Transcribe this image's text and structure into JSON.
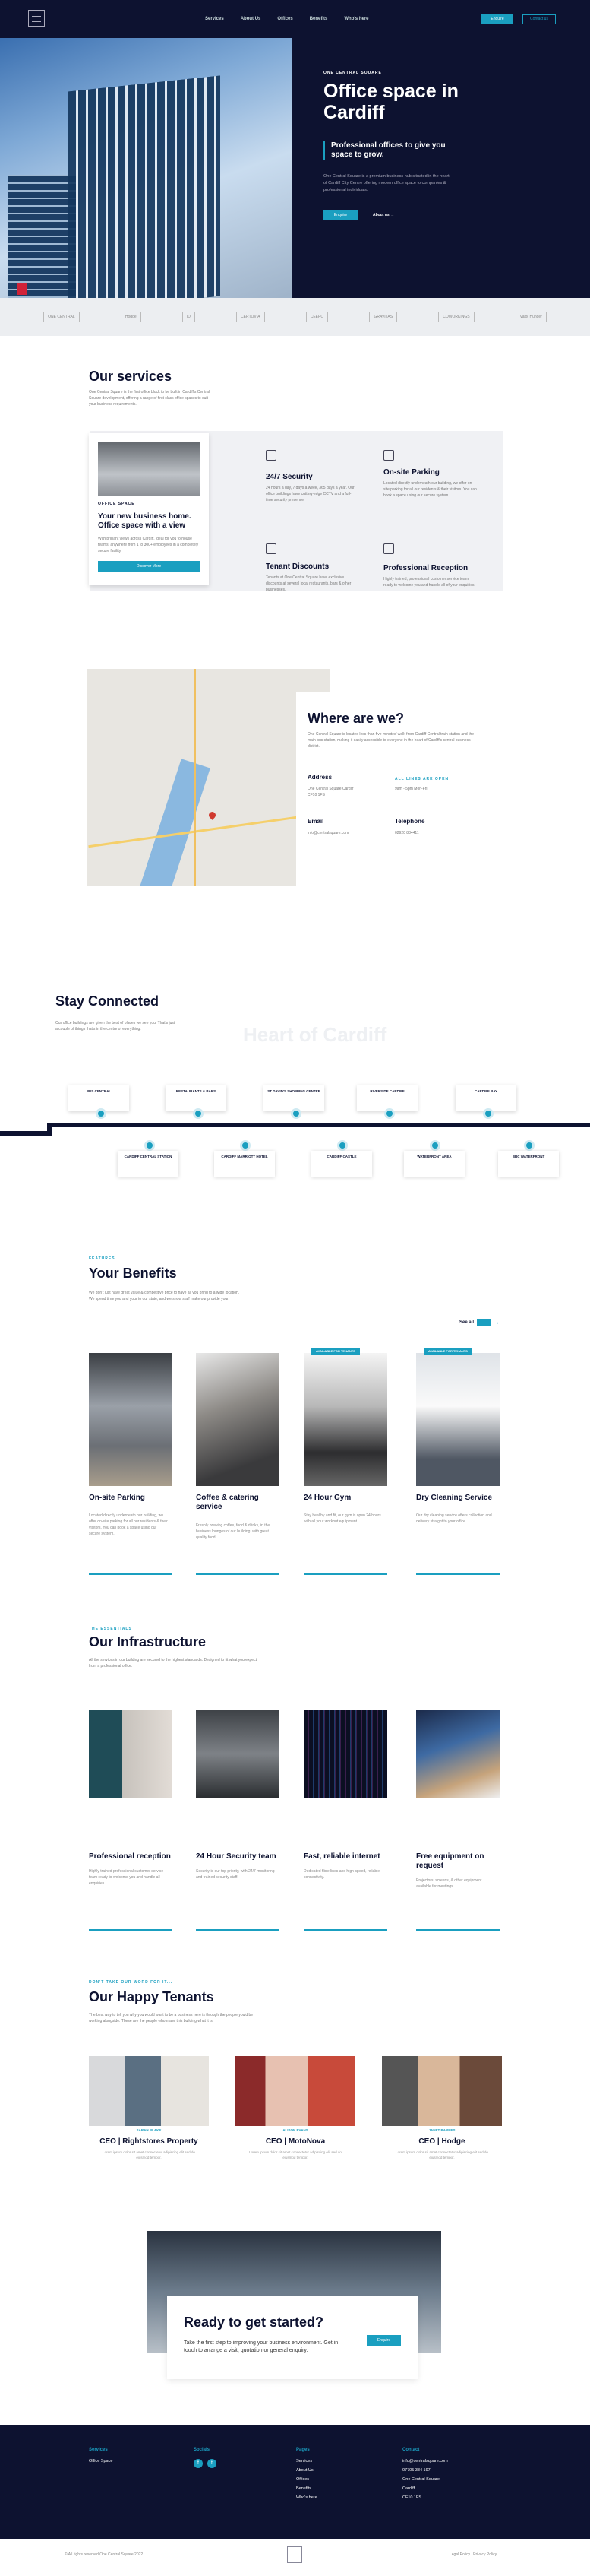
{
  "nav": {
    "links": [
      "Services",
      "About Us",
      "Offices",
      "Benefits",
      "Who's here"
    ],
    "btn_primary": "Enquire",
    "btn_secondary": "Contact us"
  },
  "hero": {
    "eyebrow": "ONE CENTRAL SQUARE",
    "title": "Office space in Cardiff",
    "quote": "Professional offices to give you space to grow.",
    "desc": "One Central Square is a premium business hub situated in the heart of Cardiff City Centre offering modern office space to companies & professional individuals.",
    "enquire": "Enquire",
    "about": "About us"
  },
  "logos": [
    "ONE CENTRAL",
    "Hodge",
    "ID",
    "CERTOVIA",
    "CEEPO",
    "GRAVITAS",
    "COWORKINGS",
    "Valor Hunger"
  ],
  "services": {
    "title": "Our services",
    "intro": "One Central Square is the first office block to be built in Cardiff's Central Square development, offering a range of first class office spaces to suit your business requirements.",
    "card_label": "OFFICE SPACE",
    "card_title": "Your new business home. Office space with a view",
    "card_text": "With brilliant views across Cardiff, ideal for you to house teams, anywhere from 1 to 300+ employees in a completely secure facility.",
    "card_btn": "Discover More",
    "items": [
      {
        "name": "24/7 Security",
        "text": "24 hours a day, 7 days a week, 365 days a year. Our office buildings have cutting-edge CCTV and a full-time security presence."
      },
      {
        "name": "On-site Parking",
        "text": "Located directly underneath our building, we offer on-site parking for all our residents & their visitors. You can book a space using our secure system."
      },
      {
        "name": "Tenant Discounts",
        "text": "Tenants at One Central Square have exclusive discounts at several local restaurants, bars & other businesses."
      },
      {
        "name": "Professional Reception",
        "text": "Highly trained, professional customer service team ready to welcome you and handle all of your enquiries."
      }
    ]
  },
  "where": {
    "title": "Where are we?",
    "text": "One Central Square is located less than five minutes' walk from Cardiff Central train station and the main bus station, making it easily accessible to everyone in the heart of Cardiff's central business district.",
    "address_label": "Address",
    "address": "One Central Square Cardiff CF10 1FS",
    "hours_label": "ALL LINES ARE OPEN",
    "hours": "9am - 5pm Mon-Fri",
    "email_label": "Email",
    "email": "info@centralsquare.com",
    "phone_label": "Telephone",
    "phone": "02920 884411"
  },
  "connected": {
    "title": "Stay Connected",
    "text": "Our office buildings are given the best of places we see you. That's just a couple of things that's in the centre of everything.",
    "watermark": "Heart of Cardiff",
    "top": [
      "BUS CENTRAL",
      "RESTAURANTS & BARS",
      "ST DAVID'S SHOPPING CENTRE",
      "RIVERSIDE CARDIFF",
      "CARDIFF BAY"
    ],
    "bottom": [
      "CARDIFF CENTRAL STATION",
      "CARDIFF MARRIOTT HOTEL",
      "CARDIFF CASTLE",
      "WATERFRONT AREA",
      "BBC WATERFRONT"
    ]
  },
  "benefits": {
    "eyebrow": "FEATURES",
    "title": "Your Benefits",
    "intro": "We don't just have great value & competitive price to have all you bring to a wide location. We spend time you and your to our state, and we show staff make our provide your.",
    "see_all": "See all",
    "items": [
      {
        "title": "On-site Parking",
        "text": "Located directly underneath our building, we offer on-site parking for all our residents & their visitors. You can book a space using our secure system."
      },
      {
        "title": "Coffee & catering service",
        "text": "Freshly brewing coffee, food & drinks, in the business lounges of our building, with great quality food."
      },
      {
        "title": "24 Hour Gym",
        "text": "Stay healthy and fit, our gym is open 24 hours with all your workout equipment.",
        "tag": "AVAILABLE FOR TENANTS"
      },
      {
        "title": "Dry Cleaning Service",
        "text": "Our dry cleaning service offers collection and delivery straight to your office.",
        "tag": "AVAILABLE FOR TENANTS"
      }
    ]
  },
  "infra": {
    "eyebrow": "THE ESSENTIALS",
    "title": "Our Infrastructure",
    "intro": "All the services in our building are secured to the highest standards. Designed to fit what you expect from a professional office.",
    "items": [
      {
        "title": "Professional reception",
        "text": "Highly trained professional customer service team ready to welcome you and handle all enquiries."
      },
      {
        "title": "24 Hour Security team",
        "text": "Security is our top priority, with 24/7 monitoring and trained security staff."
      },
      {
        "title": "Fast, reliable internet",
        "text": "Dedicated fibre lines and high-speed, reliable connectivity."
      },
      {
        "title": "Free equipment on request",
        "text": "Projectors, screens, & other equipment available for meetings."
      }
    ]
  },
  "tenants": {
    "eyebrow": "DON'T TAKE OUR WORD FOR IT...",
    "title": "Our Happy Tenants",
    "intro": "The best way to tell you why you would want to be a business here is through the people you'd be working alongside. These are the people who make this building what it is.",
    "items": [
      {
        "label": "SARAH BLAKE",
        "name": "CEO | Rightstores Property",
        "text": "Lorem ipsum dolor sit amet consectetur adipiscing elit sed do eiusmod tempor."
      },
      {
        "label": "ALISON EVANS",
        "name": "CEO | MotoNova",
        "text": "Lorem ipsum dolor sit amet consectetur adipiscing elit sed do eiusmod tempor."
      },
      {
        "label": "JANET BARNES",
        "name": "CEO | Hodge",
        "text": "Lorem ipsum dolor sit amet consectetur adipiscing elit sed do eiusmod tempor."
      }
    ]
  },
  "cta": {
    "title": "Ready to get started?",
    "text": "Take the first step to improving your business environment. Get in touch to arrange a visit, quotation or general enquiry.",
    "btn": "Enquire"
  },
  "footer": {
    "col1": "Services",
    "col1_item": "Office Space",
    "col2": "Socials",
    "col3": "Pages",
    "pages": [
      "Services",
      "About Us",
      "Offices",
      "Benefits",
      "Who's here"
    ],
    "col4": "Contact",
    "contact": [
      "info@centralsquare.com",
      "07705 384 197",
      "One Central Square",
      "Cardiff",
      "CF10 1FS"
    ],
    "copyright": "© All rights reserved One Central Square 2022",
    "legal": "Legal Policy   Privacy Policy"
  }
}
